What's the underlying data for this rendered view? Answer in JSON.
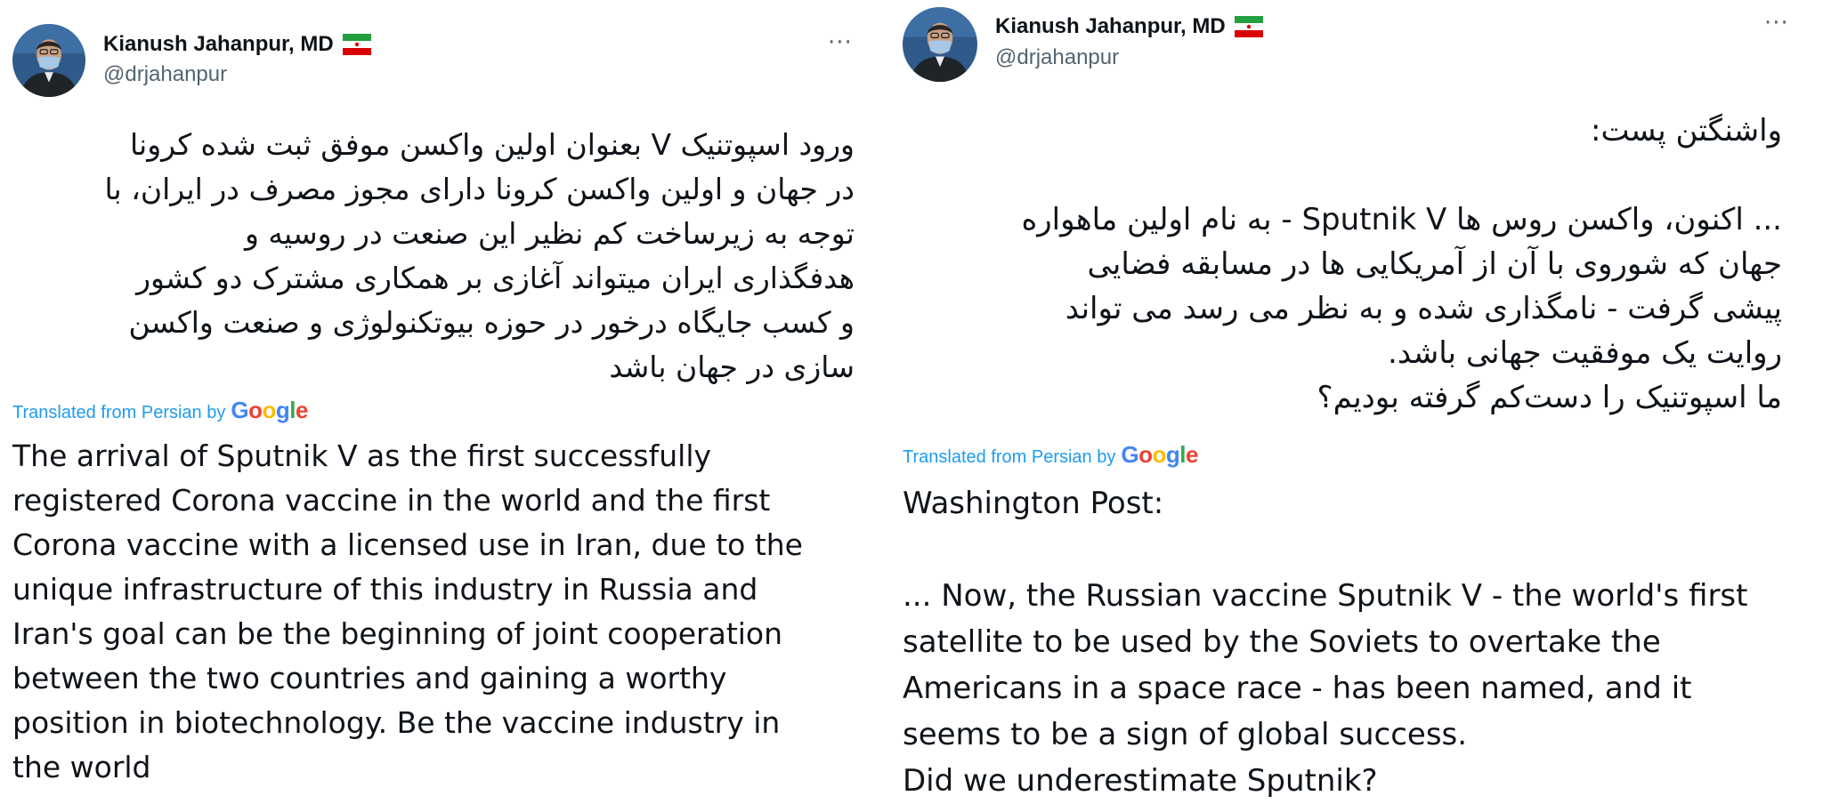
{
  "tweets": [
    {
      "author": {
        "display_name": "Kianush Jahanpur, MD",
        "handle": "@drjahanpur",
        "flag_icon": "iran-flag-icon",
        "avatar_icon": "profile-photo-masked-man"
      },
      "more_label": "···",
      "original_text": "ورود اسپوتنیک V بعنوان اولین واکسن موفق ثبت شده کرونا\nدر جهان و اولین واکسن کرونا دارای مجوز مصرف در ایران، با\nتوجه به زیرساخت کم نظیر این صنعت در روسیه و\nهدفگذاری ایران میتواند آغازی بر همکاری مشترک دو کشور\nو کسب جایگاه درخور در حوزه بیوتکنولوژی و صنعت واکسن\nسازی در جهان باشد",
      "translated_label": "Translated from Persian by",
      "translator_logo": "Google",
      "translation": "The arrival of Sputnik V as the first successfully\nregistered Corona vaccine in the world and the first\nCorona vaccine with a licensed use in Iran, due to the\nunique infrastructure of this industry in Russia and\nIran's goal can be the beginning of joint cooperation\nbetween the two countries and gaining a worthy\nposition in biotechnology. Be the vaccine industry in\nthe world"
    },
    {
      "author": {
        "display_name": "Kianush Jahanpur, MD",
        "handle": "@drjahanpur",
        "flag_icon": "iran-flag-icon",
        "avatar_icon": "profile-photo-masked-man"
      },
      "more_label": "···",
      "original_text": "واشنگتن پست:\n\n... اکنون، واکسن روس ها Sputnik V - به نام اولین ماهواره\nجهان که شوروی با آن از آمریکایی ها در مسابقه فضایی\nپیشی گرفت - نامگذاری شده و به نظر می رسد می تواند\nروایت یک موفقیت جهانی باشد.\nما اسپوتنیک را دست‌کم گرفته بودیم؟",
      "translated_label": "Translated from Persian by",
      "translator_logo": "Google",
      "translation": "Washington Post:\n\n ... Now, the Russian vaccine Sputnik V - the world's first\nsatellite to be used by the Soviets to overtake the\nAmericans in a space race - has been named, and it\nseems to be a sign of global success.\n Did we underestimate Sputnik?"
    }
  ],
  "colors": {
    "text_primary": "#0f1419",
    "text_secondary": "#536471",
    "link_blue": "#1d9bf0",
    "background": "#ffffff"
  }
}
